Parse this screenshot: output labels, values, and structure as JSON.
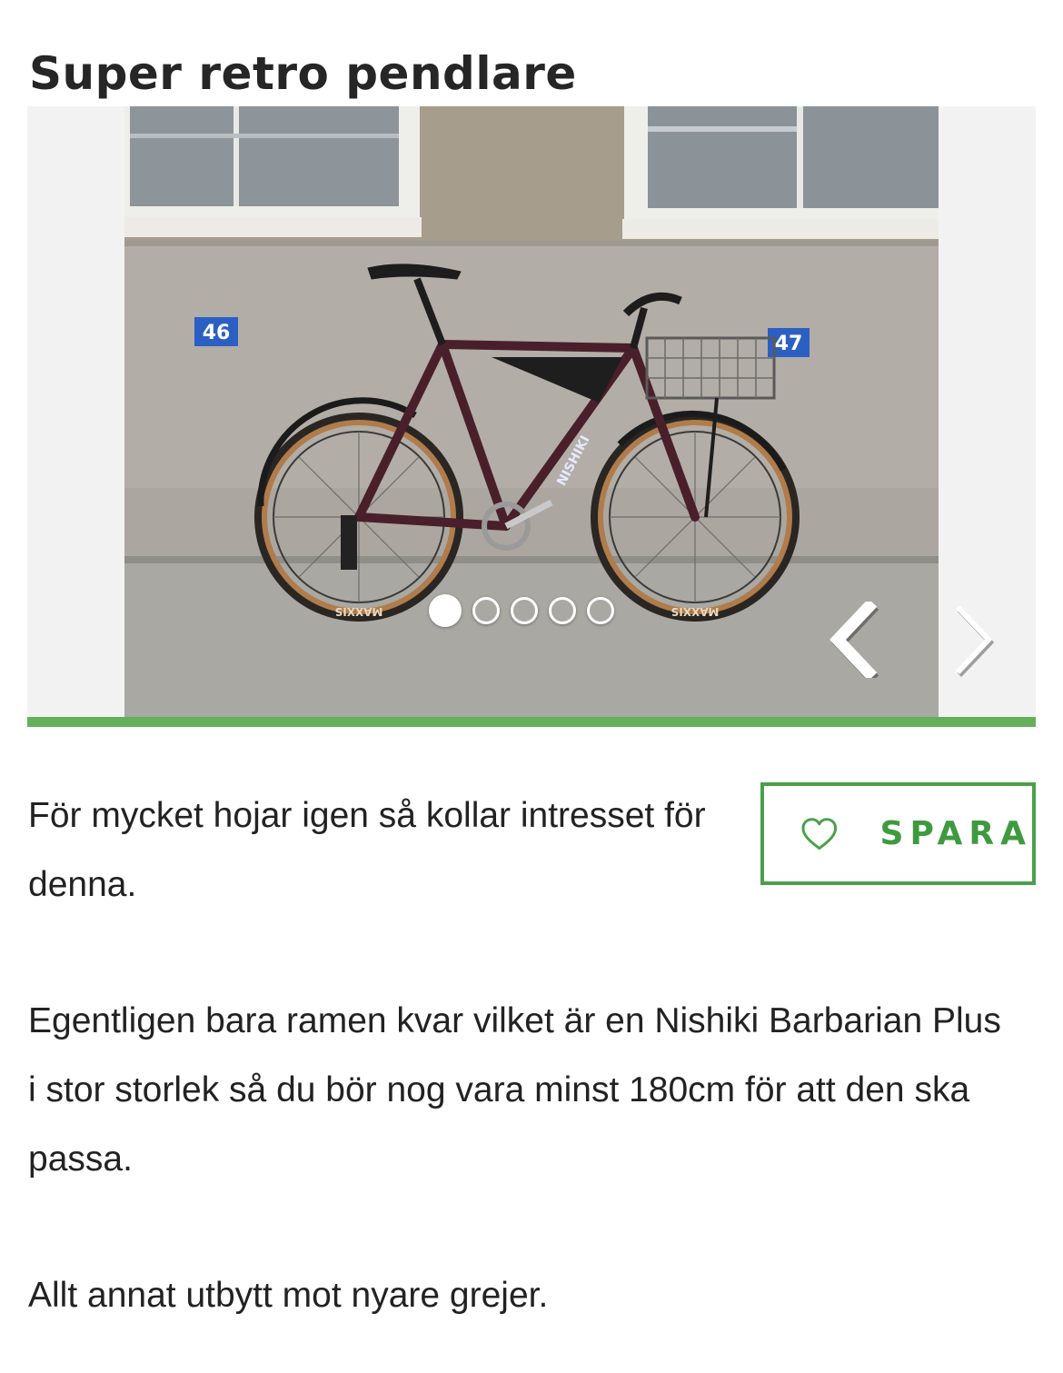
{
  "listing": {
    "title": "Super retro pendlare"
  },
  "gallery": {
    "image_count": 5,
    "active_index": 0,
    "prev_icon": "chevron-left-icon",
    "next_icon": "chevron-right-icon",
    "photo": {
      "house_number_left": "46",
      "house_number_right": "47",
      "tire_brand": "MAXXIS",
      "frame_brand": "NISHIKI"
    }
  },
  "save": {
    "label": "SPARA",
    "icon": "heart-icon"
  },
  "description": {
    "paragraphs": [
      "För mycket hojar igen så kollar intresset för denna.",
      "Egentligen bara ramen kvar vilket är en Nishiki Barbarian Plus i stor storlek så du bör nog vara minst 180cm för att den ska passa.",
      "Allt annat utbytt mot nyare grejer."
    ]
  },
  "colors": {
    "accent_green": "#64b05a",
    "button_green": "#3f9a3f",
    "text": "#222222"
  }
}
